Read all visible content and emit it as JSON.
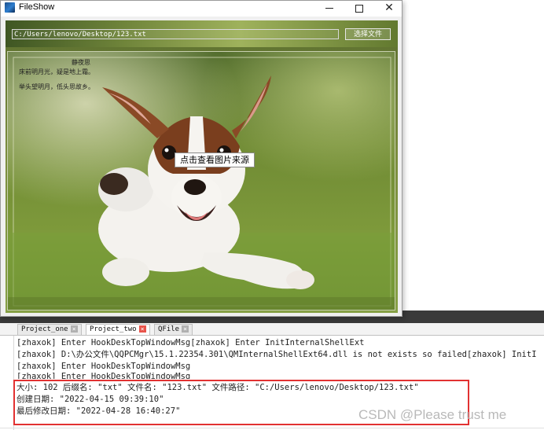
{
  "window": {
    "title": "FileShow",
    "controls": {
      "minimize": "minimize-icon",
      "maximize": "maximize-icon",
      "close": "close-icon"
    }
  },
  "toolbar": {
    "path_value": "C:/Users/lenovo/Desktop/123.txt",
    "choose_button": "选择文件"
  },
  "content": {
    "poem_title": "静夜思",
    "poem_line1": "床前明月光，疑是地上霜。",
    "poem_line2": "举头望明月，低头思故乡。",
    "source_button": "点击查看图片来源"
  },
  "ide": {
    "tabs": [
      {
        "label": "Project_one"
      },
      {
        "label": "Project_two"
      },
      {
        "label": "QFile"
      }
    ],
    "log_lines": [
      "[zhaxok] Enter HookDeskTopWindowMsg[zhaxok] Enter InitInternalShellExt",
      "[zhaxok] D:\\办公文件\\QQPCMgr\\15.1.22354.301\\QMInternalShellExt64.dll is not exists so failed[zhaxok] InitI",
      "[zhaxok] Enter HookDeskTopWindowMsg",
      "[zhaxok] Enter HookDeskTopWindowMsg"
    ],
    "result_lines": [
      "大小: 102 后缀名: \"txt\" 文件名: \"123.txt\" 文件路径: \"C:/Users/lenovo/Desktop/123.txt\"",
      "创建日期: \"2022-04-15 09:39:10\"",
      "最后修改日期: \"2022-04-28 16:40:27\""
    ]
  },
  "watermark": "CSDN @Please trust me",
  "colors": {
    "highlight": "#e23131",
    "active_tab_close": "#e8534a"
  }
}
